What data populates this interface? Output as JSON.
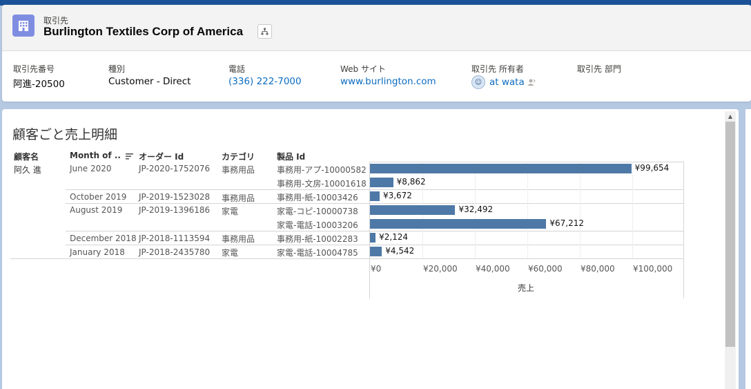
{
  "header": {
    "object_type": "取引先",
    "record_name": "Burlington Textiles Corp of America",
    "fields": [
      {
        "label": "取引先番号",
        "value": "阿進-20500"
      },
      {
        "label": "種別",
        "value": "Customer - Direct"
      },
      {
        "label": "電話",
        "value": "(336) 222-7000"
      },
      {
        "label": "Web サイト",
        "value": "www.burlington.com"
      },
      {
        "label": "取引先 所有者",
        "value": "at wata"
      },
      {
        "label": "取引先 部門",
        "value": ""
      }
    ]
  },
  "viz": {
    "title": "顧客ごと売上明細",
    "columns": [
      "顧客名",
      "Month of ..",
      "オーダー Id",
      "カテゴリ",
      "製品 Id"
    ],
    "customer": "阿久 進",
    "rows": [
      {
        "month": "June 2020",
        "order": "JP-2020-1752076",
        "category": "事務用品",
        "product": "事務用-アプ-10000582",
        "value_label": "¥99,654"
      },
      {
        "month": "",
        "order": "",
        "category": "",
        "product": "事務用-文房-10001618",
        "value_label": "¥8,862"
      },
      {
        "month": "October 2019",
        "order": "JP-2019-1523028",
        "category": "事務用品",
        "product": "事務用-紙-10003426",
        "value_label": "¥3,672"
      },
      {
        "month": "August 2019",
        "order": "JP-2019-1396186",
        "category": "家電",
        "product": "家電-コピ-10000738",
        "value_label": "¥32,492"
      },
      {
        "month": "",
        "order": "",
        "category": "",
        "product": "家電-電話-10003206",
        "value_label": "¥67,212"
      },
      {
        "month": "December 2018",
        "order": "JP-2018-1113594",
        "category": "事務用品",
        "product": "事務用-紙-10002283",
        "value_label": "¥2,124"
      },
      {
        "month": "January 2018",
        "order": "JP-2018-2435780",
        "category": "家電",
        "product": "家電-電話-10004785",
        "value_label": "¥4,542"
      }
    ],
    "axis_ticks": [
      "¥0",
      "¥20,000",
      "¥40,000",
      "¥60,000",
      "¥80,000",
      "¥100,000"
    ],
    "axis_title": "売上"
  },
  "chart_data": {
    "type": "bar",
    "orientation": "horizontal",
    "categories": [
      "事務用-アプ-10000582",
      "事務用-文房-10001618",
      "事務用-紙-10003426",
      "家電-コピ-10000738",
      "家電-電話-10003206",
      "事務用-紙-10002283",
      "家電-電話-10004785"
    ],
    "values": [
      99654,
      8862,
      3672,
      32492,
      67212,
      2124,
      4542
    ],
    "xlabel": "売上",
    "xlim": [
      0,
      118000
    ],
    "bar_color": "#4e79a7"
  }
}
